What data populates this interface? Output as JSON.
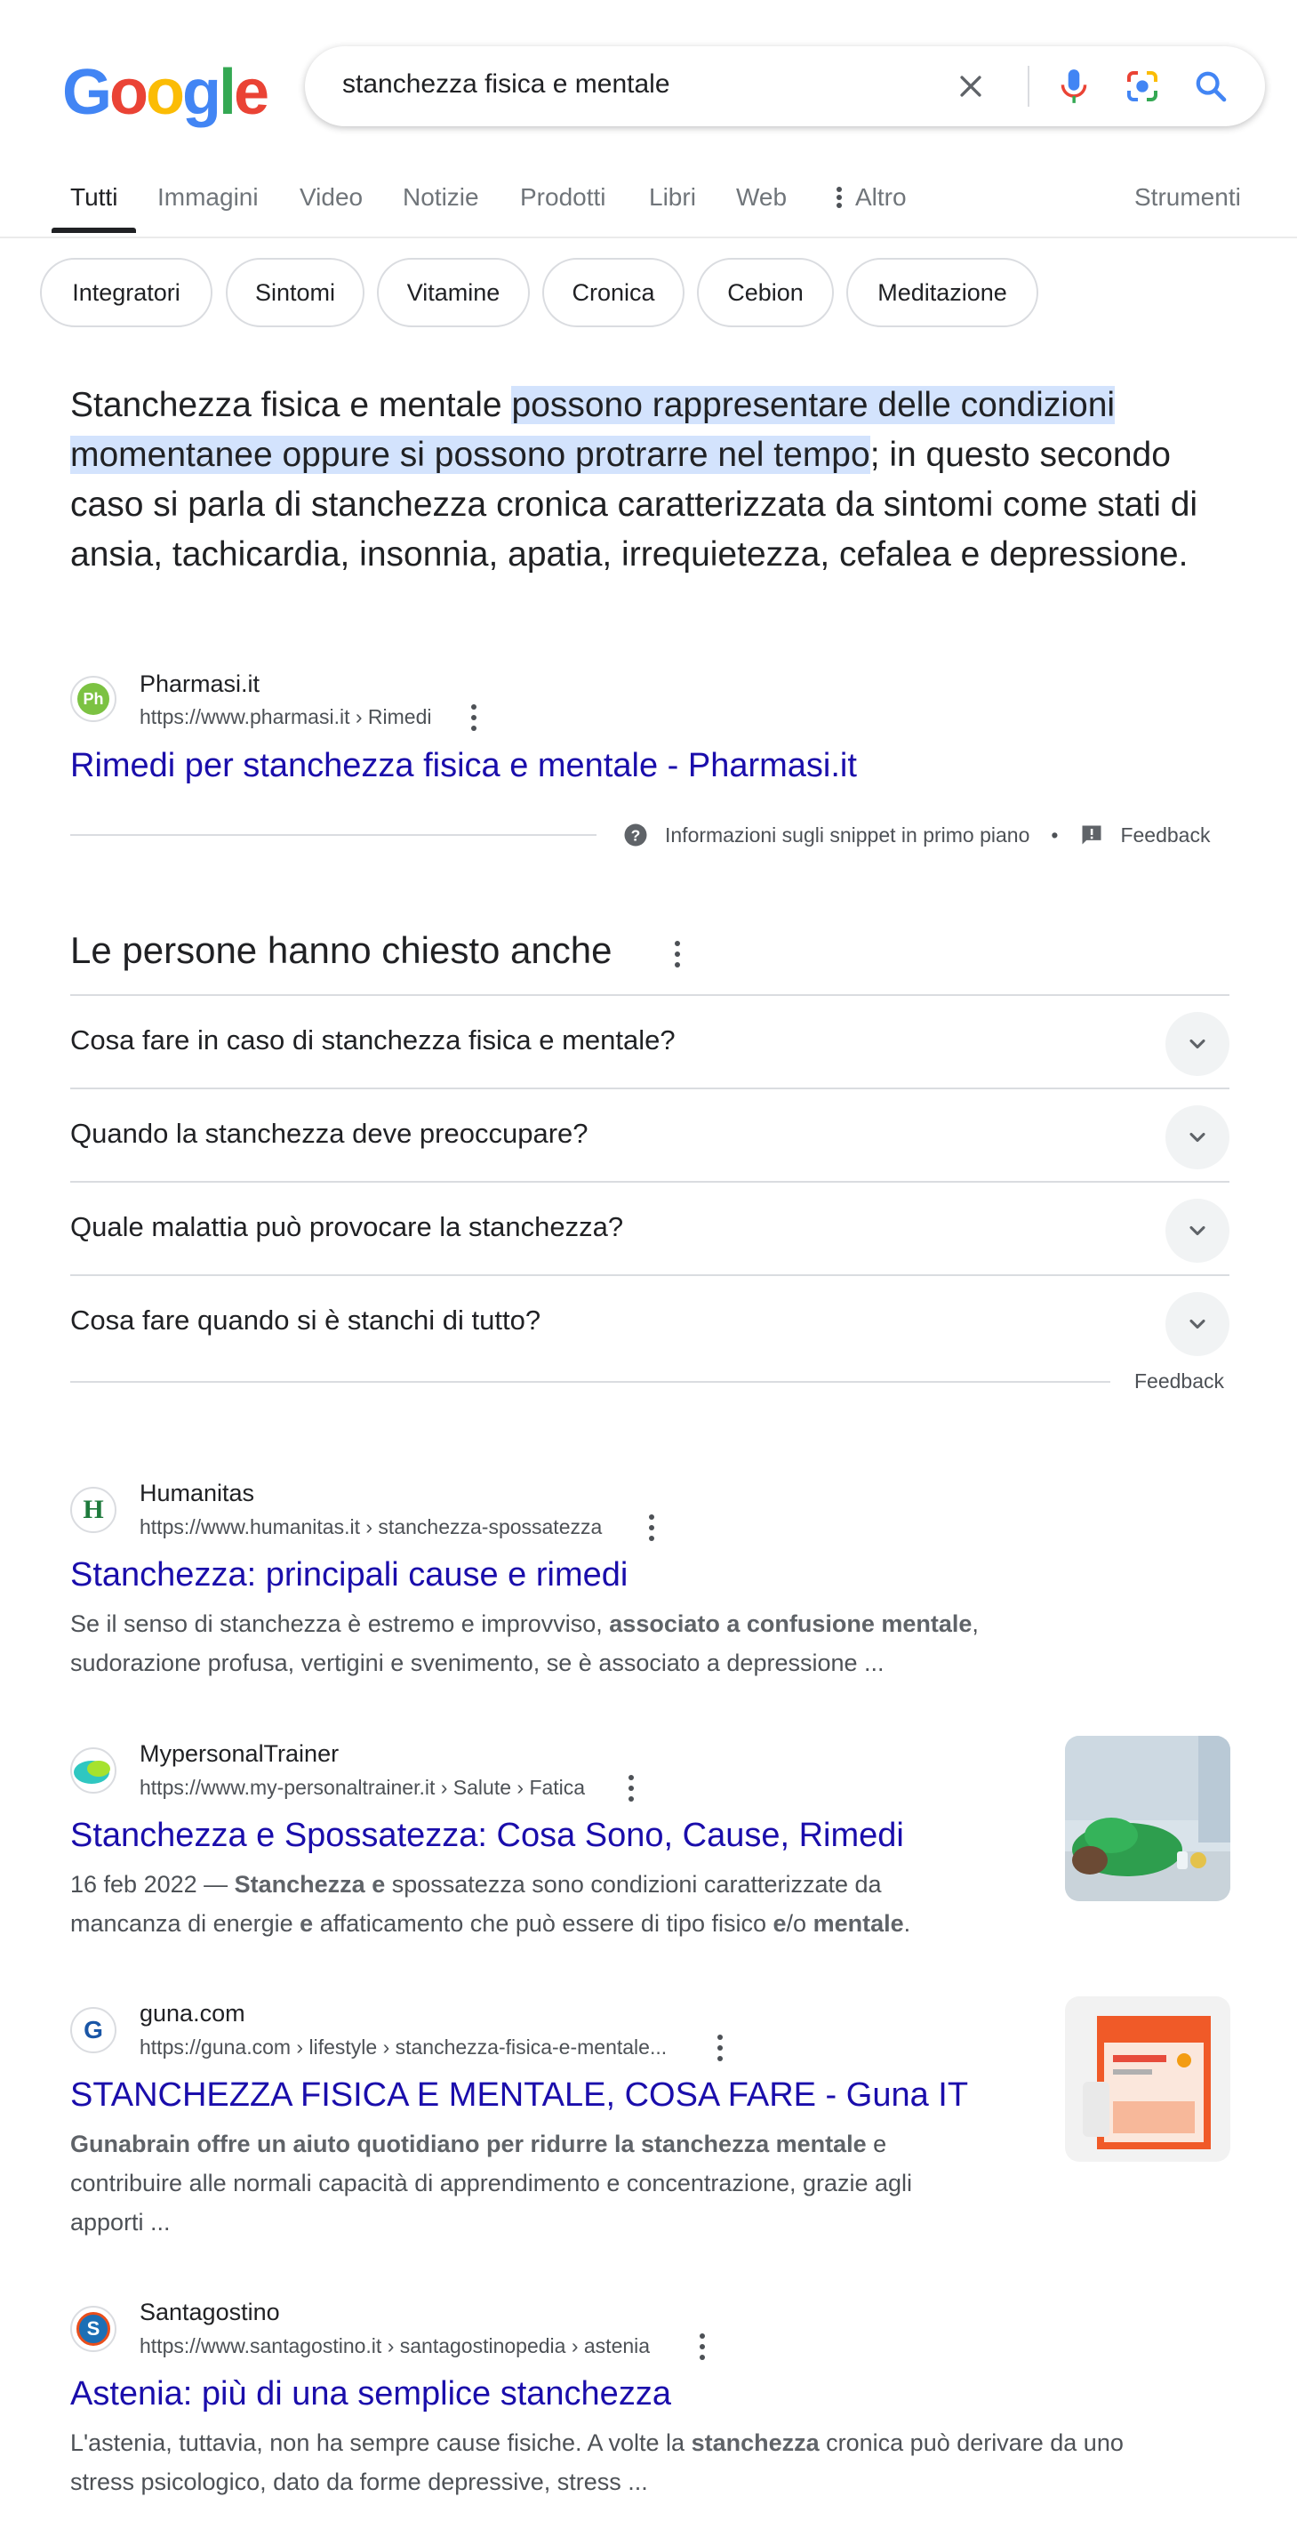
{
  "search": {
    "query": "stanchezza fisica e mentale"
  },
  "logo": {
    "letters": [
      "G",
      "o",
      "o",
      "g",
      "l",
      "e"
    ]
  },
  "tabs": [
    {
      "label": "Tutti"
    },
    {
      "label": "Immagini"
    },
    {
      "label": "Video"
    },
    {
      "label": "Notizie"
    },
    {
      "label": "Prodotti"
    },
    {
      "label": "Libri"
    },
    {
      "label": "Web"
    },
    {
      "label": "Altro"
    }
  ],
  "tools_label": "Strumenti",
  "chips": [
    "Integratori",
    "Sintomi",
    "Vitamine",
    "Cronica",
    "Cebion",
    "Meditazione"
  ],
  "featured_snippet": {
    "text_before": "Stanchezza fisica e mentale ",
    "text_highlight": "possono rappresentare delle condizioni momentanee oppure si possono protrarre nel tempo",
    "text_after": "; in questo secondo caso si parla di stanchezza cronica caratterizzata da sintomi come stati di ansia, tachicardia, insonnia, apatia, irrequietezza, cefalea e depressione.",
    "source_favicon_text": "Ph",
    "source_name": "Pharmasi.it",
    "source_url": "https://www.pharmasi.it › Rimedi",
    "title": "Rimedi per stanchezza fisica e mentale - Pharmasi.it",
    "about_label": "Informazioni sugli snippet in primo piano",
    "separator": "•",
    "feedback_label": "Feedback"
  },
  "paa": {
    "title": "Le persone hanno chiesto anche",
    "questions": [
      "Cosa fare in caso di stanchezza fisica e mentale?",
      "Quando la stanchezza deve preoccupare?",
      "Quale malattia può provocare la stanchezza?",
      "Cosa fare quando si è stanchi di tutto?"
    ],
    "feedback_label": "Feedback"
  },
  "results": [
    {
      "favicon_text": "H",
      "favicon_color": "#1e7a3c",
      "site": "Humanitas",
      "url": "https://www.humanitas.it › stanchezza-spossatezza",
      "title": "Stanchezza: principali cause e rimedi",
      "desc_parts": [
        {
          "t": "Se il senso di stanchezza è estremo e improvviso, ",
          "b": false
        },
        {
          "t": "associato a confusione mentale",
          "b": true
        },
        {
          "t": ", sudorazione profusa, vertigini e svenimento, se è associato a depressione ...",
          "b": false
        }
      ]
    },
    {
      "favicon_text": "",
      "favicon_color": "#2fc7c1",
      "site": "MypersonalTrainer",
      "url": "https://www.my-personaltrainer.it › Salute › Fatica",
      "title": "Stanchezza e Spossatezza: Cosa Sono, Cause, Rimedi",
      "desc_parts": [
        {
          "t": "16 feb 2022 — ",
          "b": false
        },
        {
          "t": "Stanchezza e",
          "b": true
        },
        {
          "t": " spossatezza sono condizioni caratterizzate da mancanza di energie ",
          "b": false
        },
        {
          "t": "e",
          "b": true
        },
        {
          "t": " affaticamento che può essere di tipo fisico ",
          "b": false
        },
        {
          "t": "e",
          "b": true
        },
        {
          "t": "/o ",
          "b": false
        },
        {
          "t": "mentale",
          "b": true
        },
        {
          "t": ".",
          "b": false
        }
      ]
    },
    {
      "favicon_text": "G",
      "favicon_color": "#1a56a6",
      "site": "guna.com",
      "url": "https://guna.com › lifestyle › stanchezza-fisica-e-mentale...",
      "title": "STANCHEZZA FISICA E MENTALE, COSA FARE - Guna IT",
      "desc_parts": [
        {
          "t": "Gunabrain offre un aiuto quotidiano per ridurre la stanchezza mentale",
          "b": true
        },
        {
          "t": " e contribuire alle normali capacità di apprendimento e concentrazione, grazie agli apporti ...",
          "b": false
        }
      ]
    },
    {
      "favicon_text": "S",
      "favicon_color": "#1c6fb5",
      "site": "Santagostino",
      "url": "https://www.santagostino.it › santagostinopedia › astenia",
      "title": "Astenia: più di una semplice stanchezza",
      "desc_parts": [
        {
          "t": "L'astenia, tuttavia, non ha sempre cause fisiche. A volte la ",
          "b": false
        },
        {
          "t": "stanchezza",
          "b": true
        },
        {
          "t": " cronica può derivare da uno stress psicologico, dato da forme depressive, stress ...",
          "b": false
        }
      ]
    }
  ],
  "colors": {
    "link": "#1a0dab",
    "highlight": "#d3e3fd",
    "mic_blue": "#4285f4",
    "mic_red": "#ea4335"
  }
}
